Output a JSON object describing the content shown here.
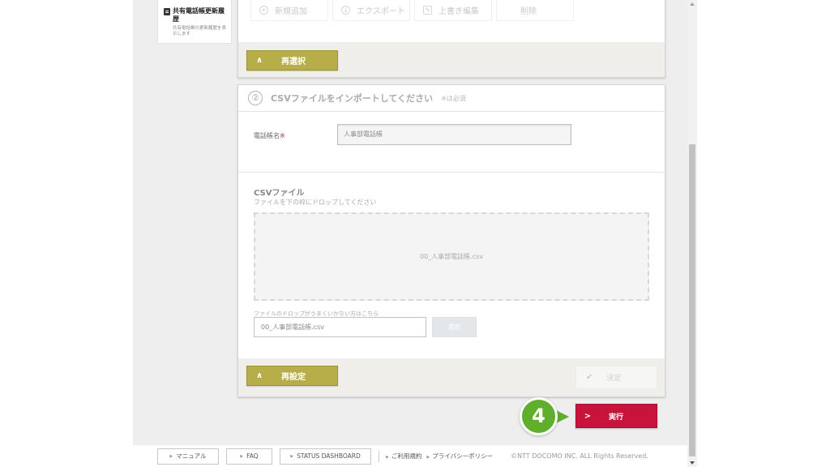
{
  "sidebar": {
    "item_title": "共有電話帳更新履歴",
    "item_desc": "共有電話帳の更新履歴を表示します"
  },
  "operations": {
    "buttons": [
      {
        "label": "新規追加",
        "icon": "plus-circle-icon"
      },
      {
        "label": "エクスポート",
        "icon": "download-circle-icon"
      },
      {
        "label": "上書き編集",
        "icon": "edit-icon"
      },
      {
        "label": "削除",
        "icon": "trash-icon"
      }
    ],
    "reselect_label": "再選択"
  },
  "import_section": {
    "step_number": "②",
    "title": "CSVファイルをインポートしてください",
    "required_note": "※は必須",
    "phonebook_label": "電話帳名",
    "required_mark": "※",
    "phonebook_value": "人事部電話帳",
    "csv_title": "CSVファイル",
    "csv_subtitle": "ファイルを下の枠にドロップしてください",
    "drop_filename": "00_人事部電話帳.csv",
    "alt_label": "ファイルのドロップがうまくいかない方はこちら",
    "file_value": "00_人事部電話帳.csv",
    "select_label": "選択",
    "reset_label": "再設定",
    "confirm_label": "決定"
  },
  "execute": {
    "label": "実行",
    "step_badge": "4"
  },
  "footer": {
    "manual": "マニュアル",
    "faq": "FAQ",
    "status": "STATUS DASHBOARD",
    "terms": "ご利用規約",
    "privacy": "プライバシーポリシー",
    "copyright": "©NTT DOCOMO INC. ALL Rights Reserved."
  },
  "colors": {
    "accent_olive": "#b8ae49",
    "execute_red": "#c8133a",
    "step_green": "#5faf2c"
  }
}
